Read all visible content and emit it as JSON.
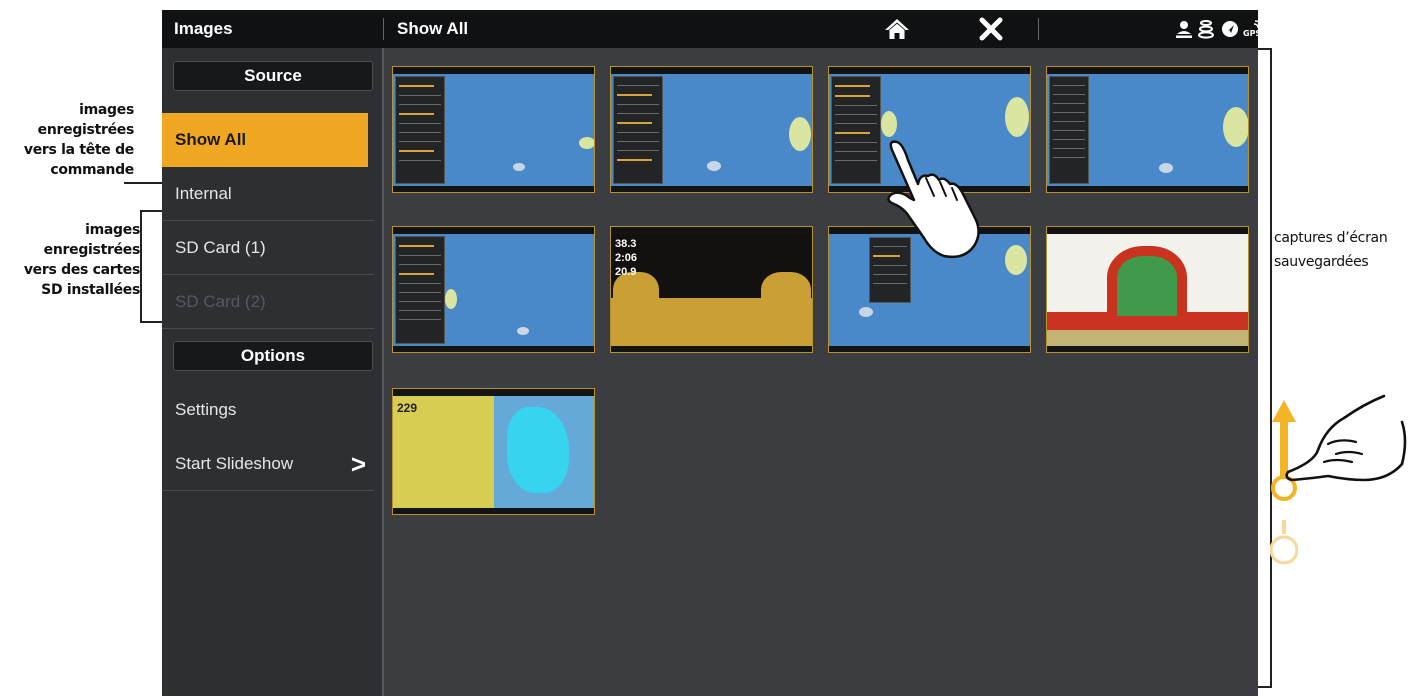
{
  "annotations": {
    "internal_text": "images enregistrées vers la tête de commande",
    "sd_text": "images enregistrées vers des cartes SD installées",
    "right_text_line1": "captures d’écran",
    "right_text_line2": "sauvegardées"
  },
  "topbar": {
    "app_title": "Images",
    "view_title": "Show All",
    "home_icon": "home-icon",
    "close_icon": "close-icon",
    "status_icons": [
      "person-icon",
      "signal-icon",
      "navigation-icon",
      "gps-icon"
    ],
    "gps_label": "GPS"
  },
  "sidebar": {
    "source_header": "Source",
    "items": [
      {
        "label": "Show All",
        "selected": true
      },
      {
        "label": "Internal",
        "selected": false
      },
      {
        "label": "SD Card (1)",
        "selected": false
      },
      {
        "label": "SD Card (2)",
        "selected": false,
        "disabled": true
      }
    ],
    "options_header": "Options",
    "options": [
      {
        "label": "Settings"
      },
      {
        "label": "Start Slideshow",
        "chevron": ">"
      }
    ]
  },
  "thumbnails": {
    "sonar_readout": [
      "38.3",
      "2:06",
      "20.9"
    ],
    "split_readout": "229"
  },
  "colors": {
    "accent": "#f0a722",
    "screen_bg": "#3b3d40",
    "sidebar_bg": "#2d2f32",
    "topbar_bg": "#101112",
    "map_water": "#4a89c9",
    "gesture": "#f3b526"
  }
}
